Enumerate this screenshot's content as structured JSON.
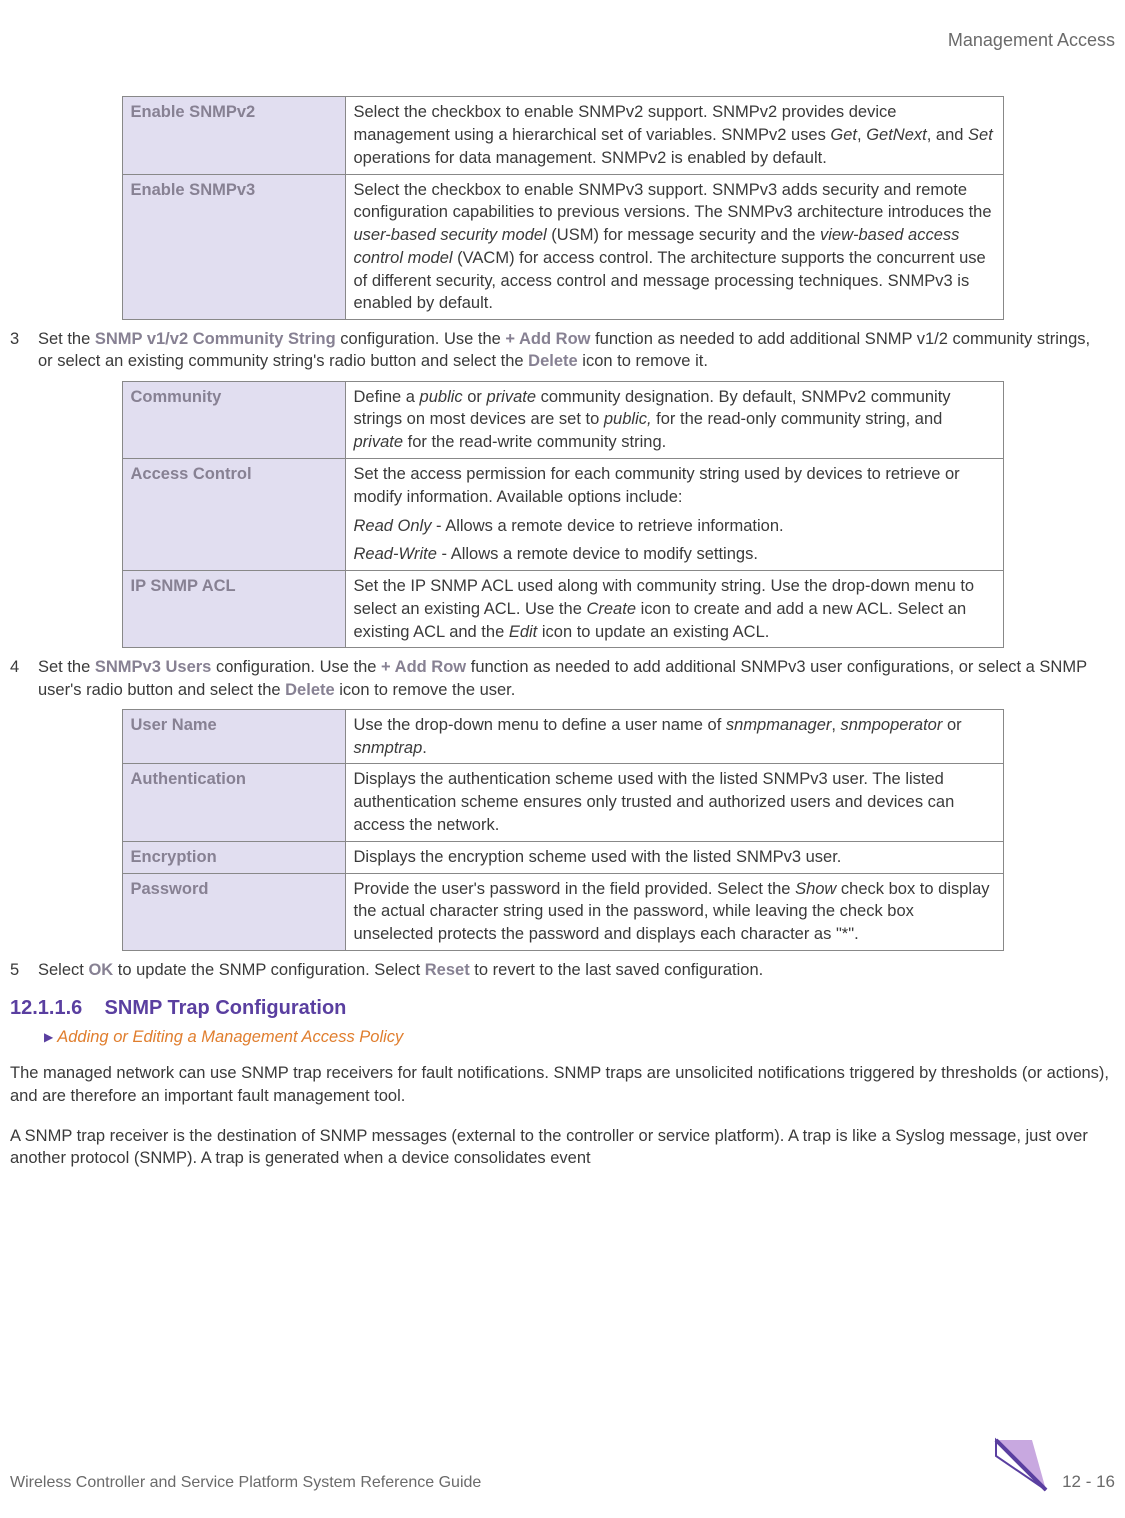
{
  "header": {
    "section_title": "Management Access"
  },
  "table1": {
    "rows": [
      {
        "label": "Enable SNMPv2",
        "desc_parts": [
          {
            "text": "Select the checkbox to enable SNMPv2 support. SNMPv2 provides device management using a hierarchical set of variables. SNMPv2 uses "
          },
          {
            "text": "Get",
            "italic": true
          },
          {
            "text": ", "
          },
          {
            "text": "GetNext",
            "italic": true
          },
          {
            "text": ", and "
          },
          {
            "text": "Set",
            "italic": true
          },
          {
            "text": " operations for data management. SNMPv2 is enabled by default."
          }
        ]
      },
      {
        "label": "Enable SNMPv3",
        "desc_parts": [
          {
            "text": "Select the checkbox to enable SNMPv3 support. SNMPv3 adds security and remote configuration capabilities to previous versions. The SNMPv3 architecture introduces the "
          },
          {
            "text": "user-based security model",
            "italic": true
          },
          {
            "text": " (USM) for message security and the "
          },
          {
            "text": "view-based access control model",
            "italic": true
          },
          {
            "text": " (VACM) for access control. The architecture supports the concurrent use of different security, access control and message processing techniques. SNMPv3 is enabled by default."
          }
        ]
      }
    ]
  },
  "step3": {
    "num": "3",
    "parts": [
      {
        "text": "Set the "
      },
      {
        "text": "SNMP v1/v2 Community String",
        "bold": true
      },
      {
        "text": " configuration. Use the "
      },
      {
        "text": "+ Add Row",
        "bold": true
      },
      {
        "text": " function as needed to add additional SNMP v1/2 community strings, or select an existing community string's radio button and select the "
      },
      {
        "text": "Delete",
        "bold": true
      },
      {
        "text": " icon to remove it."
      }
    ]
  },
  "table2": {
    "rows": [
      {
        "label": "Community",
        "paragraphs": [
          [
            {
              "text": "Define a "
            },
            {
              "text": "public",
              "italic": true
            },
            {
              "text": " or "
            },
            {
              "text": "private",
              "italic": true
            },
            {
              "text": " community designation. By default, SNMPv2 community strings on most devices are set to "
            },
            {
              "text": "public,",
              "italic": true
            },
            {
              "text": " for the read-only community string, and "
            },
            {
              "text": "private",
              "italic": true
            },
            {
              "text": " for the read-write community string."
            }
          ]
        ]
      },
      {
        "label": "Access Control",
        "paragraphs": [
          [
            {
              "text": "Set the access permission for each community string used by devices to retrieve or modify information. Available options include:"
            }
          ],
          [
            {
              "text": "Read Only",
              "italic": true
            },
            {
              "text": " - Allows a remote device to retrieve information."
            }
          ],
          [
            {
              "text": "Read-Write",
              "italic": true
            },
            {
              "text": " - Allows a remote device to modify settings."
            }
          ]
        ]
      },
      {
        "label": "IP SNMP ACL",
        "paragraphs": [
          [
            {
              "text": "Set the IP SNMP ACL used along with community string. Use the drop-down menu to select an existing ACL. Use the "
            },
            {
              "text": "Create",
              "italic": true
            },
            {
              "text": " icon to create and add a new ACL. Select an existing ACL and the "
            },
            {
              "text": "Edit",
              "italic": true
            },
            {
              "text": " icon to update an existing ACL."
            }
          ]
        ]
      }
    ]
  },
  "step4": {
    "num": "4",
    "parts": [
      {
        "text": "Set the "
      },
      {
        "text": "SNMPv3 Users",
        "bold": true
      },
      {
        "text": " configuration. Use the "
      },
      {
        "text": "+ Add Row",
        "bold": true
      },
      {
        "text": " function as needed to add additional SNMPv3 user configurations, or select a SNMP user's radio button and select the "
      },
      {
        "text": "Delete",
        "bold": true
      },
      {
        "text": " icon to remove the user."
      }
    ]
  },
  "table3": {
    "rows": [
      {
        "label": "User Name",
        "paragraphs": [
          [
            {
              "text": "Use the drop-down menu to define a user name of "
            },
            {
              "text": "snmpmanager",
              "italic": true
            },
            {
              "text": ", "
            },
            {
              "text": "snmpoperator",
              "italic": true
            },
            {
              "text": " or "
            },
            {
              "text": "snmptrap",
              "italic": true
            },
            {
              "text": "."
            }
          ]
        ]
      },
      {
        "label": "Authentication",
        "paragraphs": [
          [
            {
              "text": "Displays the authentication scheme used with the listed SNMPv3 user. The listed authentication scheme ensures only trusted and authorized users and devices can access the network."
            }
          ]
        ]
      },
      {
        "label": "Encryption",
        "paragraphs": [
          [
            {
              "text": "Displays the encryption scheme used with the listed SNMPv3 user."
            }
          ]
        ]
      },
      {
        "label": "Password",
        "paragraphs": [
          [
            {
              "text": "Provide the user's password in the field provided. Select the "
            },
            {
              "text": "Show",
              "italic": true
            },
            {
              "text": " check box to display the actual character string used in the password, while leaving the check box unselected protects the password and displays each character as \"*\"."
            }
          ]
        ]
      }
    ]
  },
  "step5": {
    "num": "5",
    "parts": [
      {
        "text": "Select "
      },
      {
        "text": "OK",
        "bold": true
      },
      {
        "text": " to update the SNMP configuration. Select "
      },
      {
        "text": "Reset",
        "bold": true
      },
      {
        "text": " to revert to the last saved configuration."
      }
    ]
  },
  "heading": {
    "number": "12.1.1.6",
    "title": "SNMP Trap Configuration"
  },
  "breadcrumb": {
    "link": "Adding or Editing a Management Access Policy"
  },
  "para1": "The managed network can use SNMP trap receivers for fault notifications. SNMP traps are unsolicited notifications triggered by thresholds (or actions), and are therefore an important fault management tool.",
  "para2": "A SNMP trap receiver is the destination of SNMP messages (external to the controller or service platform). A trap is like a Syslog message, just over another protocol (SNMP). A trap is generated when a device consolidates event",
  "footer": {
    "left": "Wireless Controller and Service Platform System Reference Guide",
    "page": "12 - 16"
  }
}
